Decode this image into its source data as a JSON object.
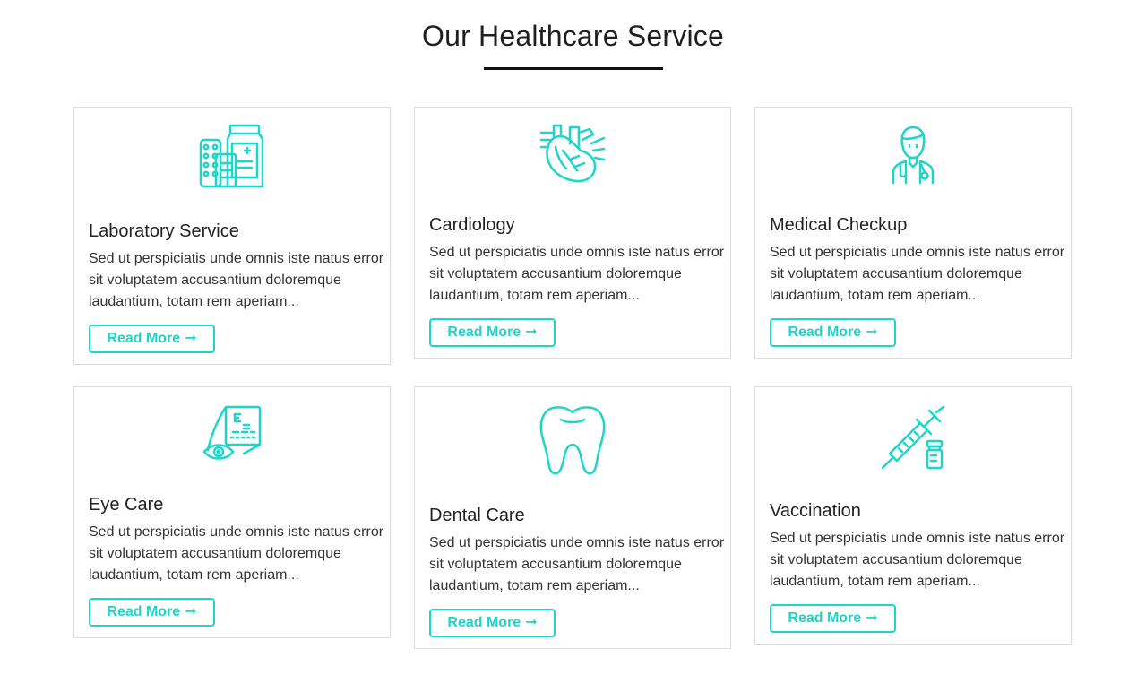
{
  "section": {
    "title": "Our Healthcare Service"
  },
  "accent_color": "#1dd6c9",
  "services": [
    {
      "icon": "medicine-bottles-icon",
      "title": "Laboratory Service",
      "text": "Sed ut perspiciatis unde omnis iste natus error sit voluptatem accusantium doloremque laudantium, totam rem aperiam...",
      "button": "Read More",
      "button_icon": "➞"
    },
    {
      "icon": "heart-icon",
      "title": "Cardiology",
      "text": "Sed ut perspiciatis unde omnis iste natus error sit voluptatem accusantium doloremque laudantium, totam rem aperiam...",
      "button": "Read More",
      "button_icon": "➞"
    },
    {
      "icon": "doctor-icon",
      "title": "Medical Checkup",
      "text": "Sed ut perspiciatis unde omnis iste natus error sit voluptatem accusantium doloremque laudantium, totam rem aperiam...",
      "button": "Read More",
      "button_icon": "➞"
    },
    {
      "icon": "eye-chart-icon",
      "title": "Eye Care",
      "text": "Sed ut perspiciatis unde omnis iste natus error sit voluptatem accusantium doloremque laudantium, totam rem aperiam...",
      "button": "Read More",
      "button_icon": "➞"
    },
    {
      "icon": "tooth-icon",
      "title": "Dental Care",
      "text": "Sed ut perspiciatis unde omnis iste natus error sit voluptatem accusantium doloremque laudantium, totam rem aperiam...",
      "button": "Read More",
      "button_icon": "➞"
    },
    {
      "icon": "syringe-icon",
      "title": "Vaccination",
      "text": "Sed ut perspiciatis unde omnis iste natus error sit voluptatem accusantium doloremque laudantium, totam rem aperiam...",
      "button": "Read More",
      "button_icon": "➞"
    }
  ]
}
